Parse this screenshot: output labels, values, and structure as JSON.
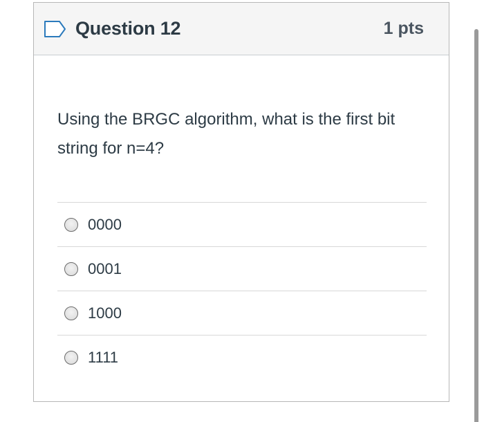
{
  "question": {
    "title": "Question 12",
    "points": "1 pts",
    "text": "Using the BRGC algorithm, what is the first bit string for n=4?"
  },
  "answers": [
    {
      "label": "0000"
    },
    {
      "label": "0001"
    },
    {
      "label": "1000"
    },
    {
      "label": "1111"
    }
  ],
  "colors": {
    "header_bg": "#f5f5f5",
    "text": "#2d3b45",
    "flag_outline": "#2b7abc",
    "divider": "#d8d8d8"
  },
  "icons": {
    "flag": "flag-outline-icon"
  }
}
